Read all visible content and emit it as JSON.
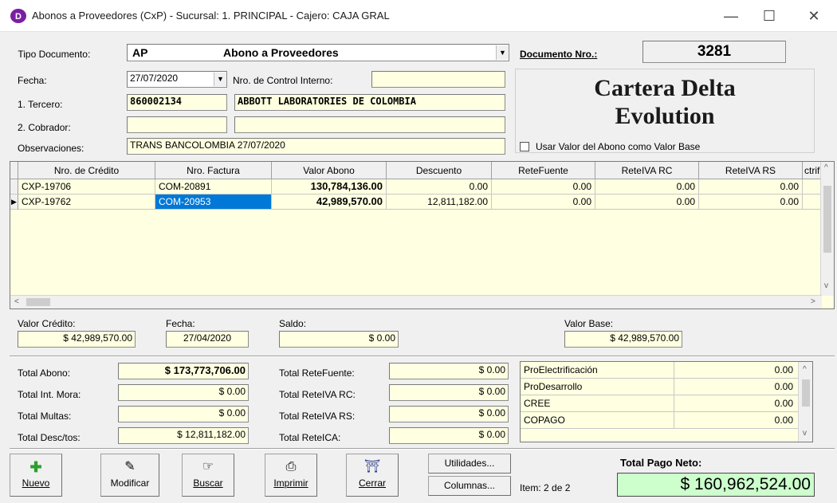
{
  "window": {
    "title": "Abonos a Proveedores (CxP) - Sucursal: 1. PRINCIPAL - Cajero: CAJA GRAL",
    "minimize": "—",
    "maximize": "☐",
    "close": "✕"
  },
  "header": {
    "tipo_documento_label": "Tipo Documento:",
    "tipo_code": "AP",
    "tipo_name": "Abono a Proveedores",
    "documento_label": "Documento Nro.:",
    "documento_nro": "3281",
    "fecha_label": "Fecha:",
    "fecha": "27/07/2020",
    "control_label": "Nro. de Control Interno:",
    "control_value": "",
    "tercero_label": "1. Tercero:",
    "tercero_id": "860002134",
    "tercero_name": "ABBOTT LABORATORIES DE COLOMBIA",
    "cobrador_label": "2. Cobrador:",
    "cobrador_id": "",
    "cobrador_name": "",
    "observaciones_label": "Observaciones:",
    "observaciones": "TRANS BANCOLOMBIA 27/07/2020",
    "brand_line1": "Cartera Delta",
    "brand_line2": "Evolution",
    "usar_valor_label": "Usar Valor del Abono como Valor Base"
  },
  "grid": {
    "columns": [
      "Nro. de Crédito",
      "Nro. Factura",
      "Valor Abono",
      "Descuento",
      "ReteFuente",
      "ReteIVA RC",
      "ReteIVA RS",
      "ctrifi"
    ],
    "rows": [
      [
        "CXP-19706",
        "COM-20891",
        "130,784,136.00",
        "0.00",
        "0.00",
        "0.00",
        "0.00"
      ],
      [
        "CXP-19762",
        "COM-20953",
        "42,989,570.00",
        "12,811,182.00",
        "0.00",
        "0.00",
        "0.00"
      ]
    ],
    "current_row_marker": "▶"
  },
  "detail": {
    "valor_credito_label": "Valor Crédito:",
    "valor_credito": "$ 42,989,570.00",
    "fecha_label": "Fecha:",
    "fecha": "27/04/2020",
    "saldo_label": "Saldo:",
    "saldo": "$ 0.00",
    "valor_base_label": "Valor Base:",
    "valor_base": "$ 42,989,570.00"
  },
  "totals": {
    "total_abono_label": "Total Abono:",
    "total_abono": "$ 173,773,706.00",
    "int_mora_label": "Total Int. Mora:",
    "int_mora": "$ 0.00",
    "multas_label": "Total Multas:",
    "multas": "$ 0.00",
    "desc_label": "Total Desc/tos:",
    "desc": "$ 12,811,182.00",
    "retefuente_label": "Total ReteFuente:",
    "retefuente": "$ 0.00",
    "reteiva_rc_label": "Total ReteIVA RC:",
    "reteiva_rc": "$ 0.00",
    "reteiva_rs_label": "Total ReteIVA RS:",
    "reteiva_rs": "$ 0.00",
    "reteica_label": "Total ReteICA:",
    "reteica": "$ 0.00"
  },
  "extras": [
    {
      "name": "ProElectrificación",
      "value": "0.00"
    },
    {
      "name": "ProDesarrollo",
      "value": "0.00"
    },
    {
      "name": "CREE",
      "value": "0.00"
    },
    {
      "name": "COPAGO",
      "value": "0.00"
    }
  ],
  "toolbar": {
    "nuevo": "Nuevo",
    "modificar": "Modificar",
    "buscar": "Buscar",
    "imprimir": "Imprimir",
    "cerrar": "Cerrar",
    "utilidades": "Utilidades...",
    "columnas": "Columnas...",
    "item": "Item: 2 de 2",
    "total_neto_label": "Total Pago Neto:",
    "total_neto": "$ 160,962,524.00"
  },
  "icons": {
    "app": "delta-logo-icon",
    "nuevo": "plus-icon",
    "modificar": "edit-icon",
    "buscar": "search-hand-icon",
    "imprimir": "printer-icon",
    "cerrar": "exit-door-icon"
  },
  "colors": {
    "field_bg": "#ffffe1",
    "selection": "#0078d7",
    "net_bg": "#ccffcc",
    "app_icon": "#7a1fa2"
  }
}
